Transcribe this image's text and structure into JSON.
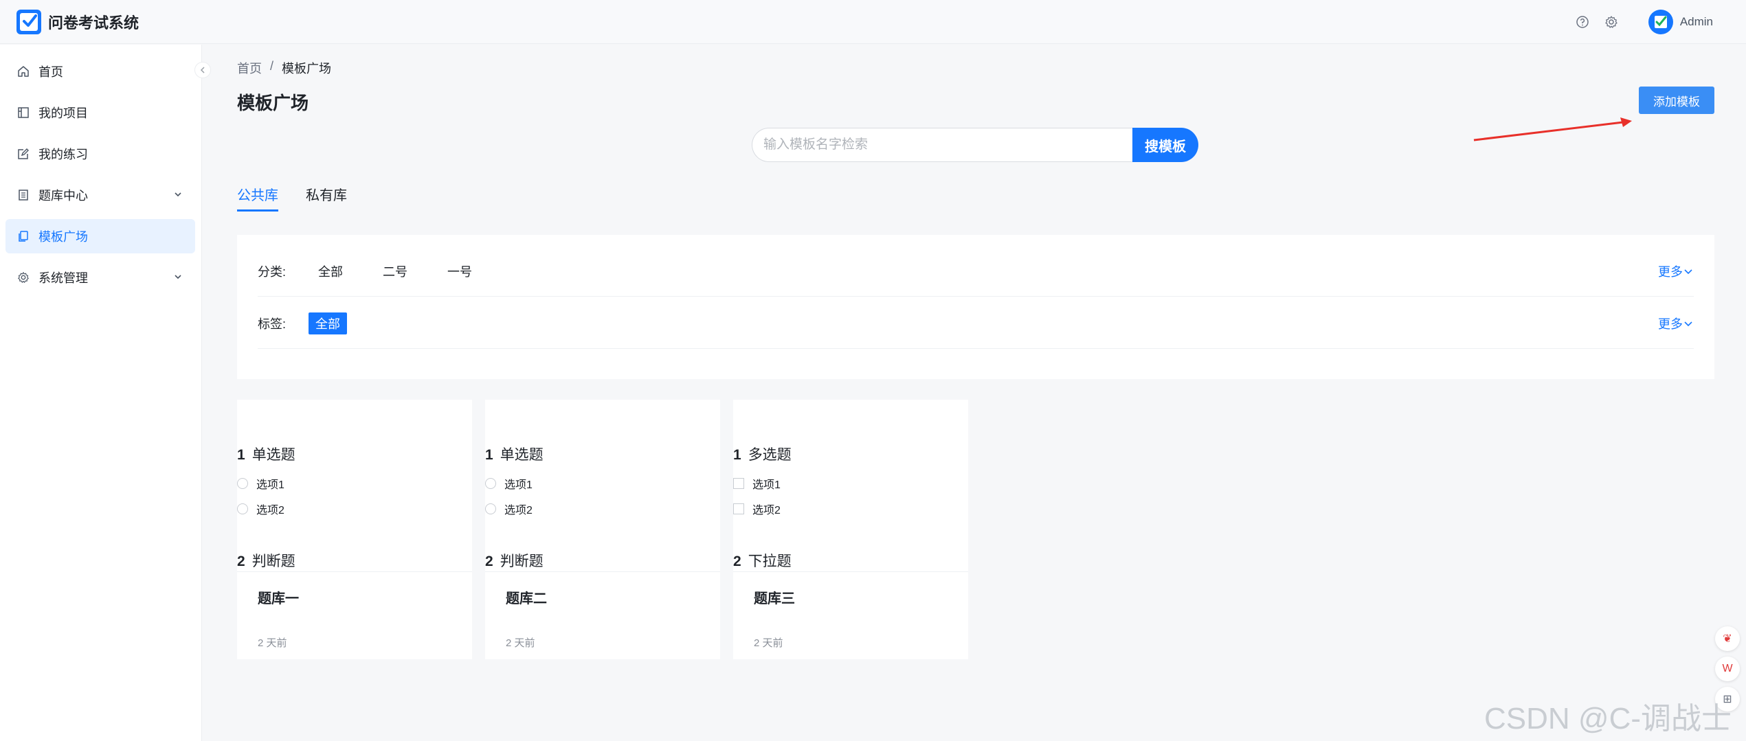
{
  "header": {
    "app_title": "问卷考试系统",
    "user_name": "Admin",
    "icons": [
      "help-icon",
      "gear-icon"
    ]
  },
  "sidebar": {
    "items": [
      {
        "label": "首页",
        "icon": "home-icon"
      },
      {
        "label": "我的项目",
        "icon": "project-icon"
      },
      {
        "label": "我的练习",
        "icon": "edit-icon"
      },
      {
        "label": "题库中心",
        "icon": "book-icon",
        "has_children": true
      },
      {
        "label": "模板广场",
        "icon": "template-icon",
        "active": true
      },
      {
        "label": "系统管理",
        "icon": "gear-icon",
        "has_children": true
      }
    ]
  },
  "breadcrumb": {
    "home": "首页",
    "separator": "/",
    "current": "模板广场"
  },
  "page": {
    "title": "模板广场",
    "add_button": "添加模板"
  },
  "search": {
    "placeholder": "输入模板名字检索",
    "button": "搜模板"
  },
  "tabs": [
    {
      "label": "公共库",
      "active": true
    },
    {
      "label": "私有库"
    }
  ],
  "filters": {
    "category_label": "分类:",
    "categories": [
      "全部",
      "二号",
      "一号"
    ],
    "tag_label": "标签:",
    "tags": [
      "全部"
    ],
    "more": "更多"
  },
  "cards": [
    {
      "q1_num": "1",
      "q1_title": "单选题",
      "q1_type": "radio",
      "options": [
        "选项1",
        "选项2"
      ],
      "q2_num": "2",
      "q2_title": "判断题",
      "name": "题库一",
      "time": "2 天前"
    },
    {
      "q1_num": "1",
      "q1_title": "单选题",
      "q1_type": "radio",
      "options": [
        "选项1",
        "选项2"
      ],
      "q2_num": "2",
      "q2_title": "判断题",
      "name": "题库二",
      "time": "2 天前"
    },
    {
      "q1_num": "1",
      "q1_title": "多选题",
      "q1_type": "checkbox",
      "options": [
        "选项1",
        "选项2"
      ],
      "q2_num": "2",
      "q2_title": "下拉题",
      "name": "题库三",
      "time": "2 天前"
    }
  ],
  "watermark": "CSDN @C-调战士",
  "colors": {
    "primary": "#1677ff",
    "add_button": "#3a8ef5",
    "annotation_arrow": "#e8302a"
  }
}
